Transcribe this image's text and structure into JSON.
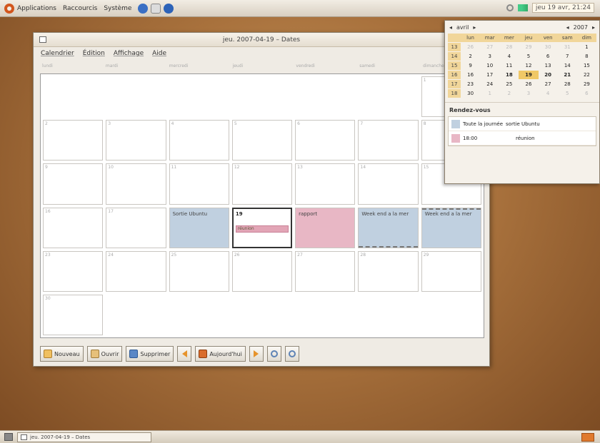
{
  "top_panel": {
    "menus": [
      "Applications",
      "Raccourcis",
      "Système"
    ],
    "clock": "jeu 19 avr, 21:24"
  },
  "window": {
    "title": "jeu. 2007-04-19 – Dates",
    "menubar": [
      "Calendrier",
      "Édition",
      "Affichage",
      "Aide"
    ],
    "weekdays": [
      "lundi",
      "mardi",
      "mercredi",
      "jeudi",
      "vendredi",
      "samedi",
      "dimanche"
    ],
    "days": [
      {
        "num": "1"
      },
      {
        "num": "2"
      },
      {
        "num": "3"
      },
      {
        "num": "4"
      },
      {
        "num": "5"
      },
      {
        "num": "6"
      },
      {
        "num": "7"
      },
      {
        "num": "8"
      },
      {
        "num": "9"
      },
      {
        "num": "10"
      },
      {
        "num": "11"
      },
      {
        "num": "12"
      },
      {
        "num": "13"
      },
      {
        "num": "14"
      },
      {
        "num": "15"
      },
      {
        "num": "16"
      },
      {
        "num": "17"
      },
      {
        "num": "18",
        "event": "Sortie Ubuntu"
      },
      {
        "num": "19",
        "bar": "réunion"
      },
      {
        "num": "20",
        "event": "rapport"
      },
      {
        "num": "21",
        "event": "Week end a la mer"
      },
      {
        "num": "22",
        "event": "Week end a la mer"
      },
      {
        "num": "23"
      },
      {
        "num": "24"
      },
      {
        "num": "25"
      },
      {
        "num": "26"
      },
      {
        "num": "27"
      },
      {
        "num": "28"
      },
      {
        "num": "29"
      },
      {
        "num": "30"
      }
    ],
    "toolbar": {
      "new": "Nouveau",
      "open": "Ouvrir",
      "delete": "Supprimer",
      "today": "Aujourd'hui"
    }
  },
  "popup": {
    "month": "avril",
    "year": "2007",
    "headers": [
      "lun",
      "mar",
      "mer",
      "jeu",
      "ven",
      "sam",
      "dim"
    ],
    "weeks": [
      {
        "wk": "13",
        "days": [
          "26",
          "27",
          "28",
          "29",
          "30",
          "31",
          "1"
        ]
      },
      {
        "wk": "14",
        "days": [
          "2",
          "3",
          "4",
          "5",
          "6",
          "7",
          "8"
        ]
      },
      {
        "wk": "15",
        "days": [
          "9",
          "10",
          "11",
          "12",
          "13",
          "14",
          "15"
        ]
      },
      {
        "wk": "16",
        "days": [
          "16",
          "17",
          "18",
          "19",
          "20",
          "21",
          "22"
        ]
      },
      {
        "wk": "17",
        "days": [
          "23",
          "24",
          "25",
          "26",
          "27",
          "28",
          "29"
        ]
      },
      {
        "wk": "18",
        "days": [
          "30",
          "1",
          "2",
          "3",
          "4",
          "5",
          "6"
        ]
      }
    ],
    "rdv_title": "Rendez-vous",
    "appointments": [
      {
        "time": "Toute la journée",
        "title": "sortie Ubuntu",
        "color": "#c0d0e0"
      },
      {
        "time": "18:00",
        "title": "réunion",
        "color": "#e8b7c5"
      }
    ]
  },
  "bottom_panel": {
    "task": "jeu. 2007-04-19 – Dates"
  },
  "colors": {
    "accent": "#d2561d",
    "event_blue": "#c0d0e0",
    "event_pink": "#e8b7c5",
    "mini_header": "#f1d69a"
  }
}
